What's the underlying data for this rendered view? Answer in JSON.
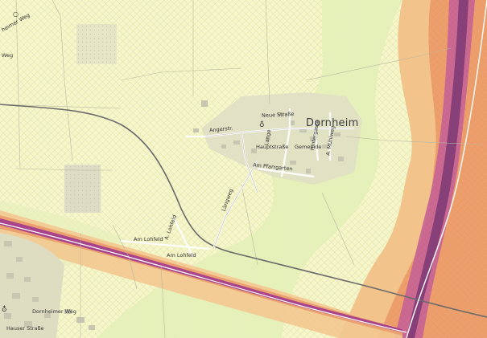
{
  "map": {
    "place_labels": {
      "dornheim": "Dornheim"
    },
    "street_labels": {
      "neue_strasse": "Neue Straße",
      "hauptstrasse": "Hauptstraße",
      "gemeindeplatz": "Gemeinde",
      "angerstrasse": "Angerstr.",
      "am_pfarrgarten": "Am Pfarrgarten",
      "laengsweg": "Längweg",
      "am_lohfeld": "Am Lohfeld",
      "am_lohfeld_2": "Am Lohfeld",
      "a_lohfeld": "A. Lohfeld",
      "dornheimer_weg": "Dornheimer Weg",
      "hauser_strasse": "Hauser Straße",
      "vertical_street_1": "Lange",
      "vertical_street_2": "Hintergasse",
      "vertical_street_3": "A. Mühlweg",
      "left_weg": "heimer Weg",
      "top_left_frag": "Weg"
    },
    "colors": {
      "background": "#f6f6cc",
      "crosshatch": "#e8e6a8",
      "light_green": "#dfeeb0",
      "orange": "#f4c48a",
      "dark_orange": "#eba070",
      "purple": "#8e3f86",
      "magenta": "#c0508e",
      "road": "#ffffff",
      "road_outline": "#b7b7b7",
      "rail": "#666666",
      "built": "#dcdcc8"
    }
  }
}
